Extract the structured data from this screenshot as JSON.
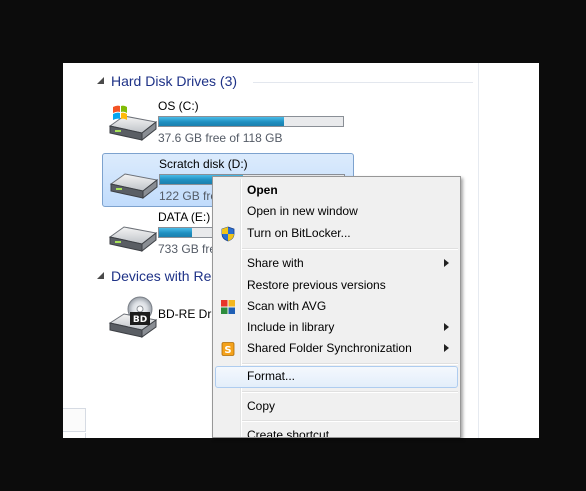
{
  "groups": {
    "hard_disks": {
      "label": "Hard Disk Drives (3)"
    },
    "devices": {
      "label": "Devices with Re"
    }
  },
  "drives": [
    {
      "name": "OS (C:)",
      "free_text": "37.6 GB free of 118 GB",
      "used_fraction": 0.68
    },
    {
      "name": "Scratch disk (D:)",
      "free_text": "122 GB free",
      "used_fraction": 0.45
    },
    {
      "name": "DATA (E:)",
      "free_text": "733 GB fre",
      "used_fraction": 0.18
    }
  ],
  "devices": [
    {
      "name": "BD-RE Driv",
      "icon_badge": "BD"
    }
  ],
  "context_menu": {
    "items": [
      {
        "label": "Open",
        "bold": true
      },
      {
        "label": "Open in new window"
      },
      {
        "label": "Turn on BitLocker...",
        "icon": "bitlocker-shield-icon"
      },
      {
        "label": "Share with",
        "submenu": true
      },
      {
        "label": "Restore previous versions"
      },
      {
        "label": "Scan with AVG",
        "icon": "avg-icon"
      },
      {
        "label": "Include in library",
        "submenu": true
      },
      {
        "label": "Shared Folder Synchronization",
        "icon": "sync-folder-icon",
        "submenu": true
      },
      {
        "label": "Format...",
        "highlighted": true
      },
      {
        "label": "Copy"
      },
      {
        "label": "Create shortcut"
      }
    ]
  },
  "colors": {
    "group_header": "#1e3287",
    "selection_fill": "#c1dcfc",
    "selection_border": "#7da2ce",
    "capacity_bar": "#1f8fc0",
    "menu_background": "#f0f0f0"
  }
}
